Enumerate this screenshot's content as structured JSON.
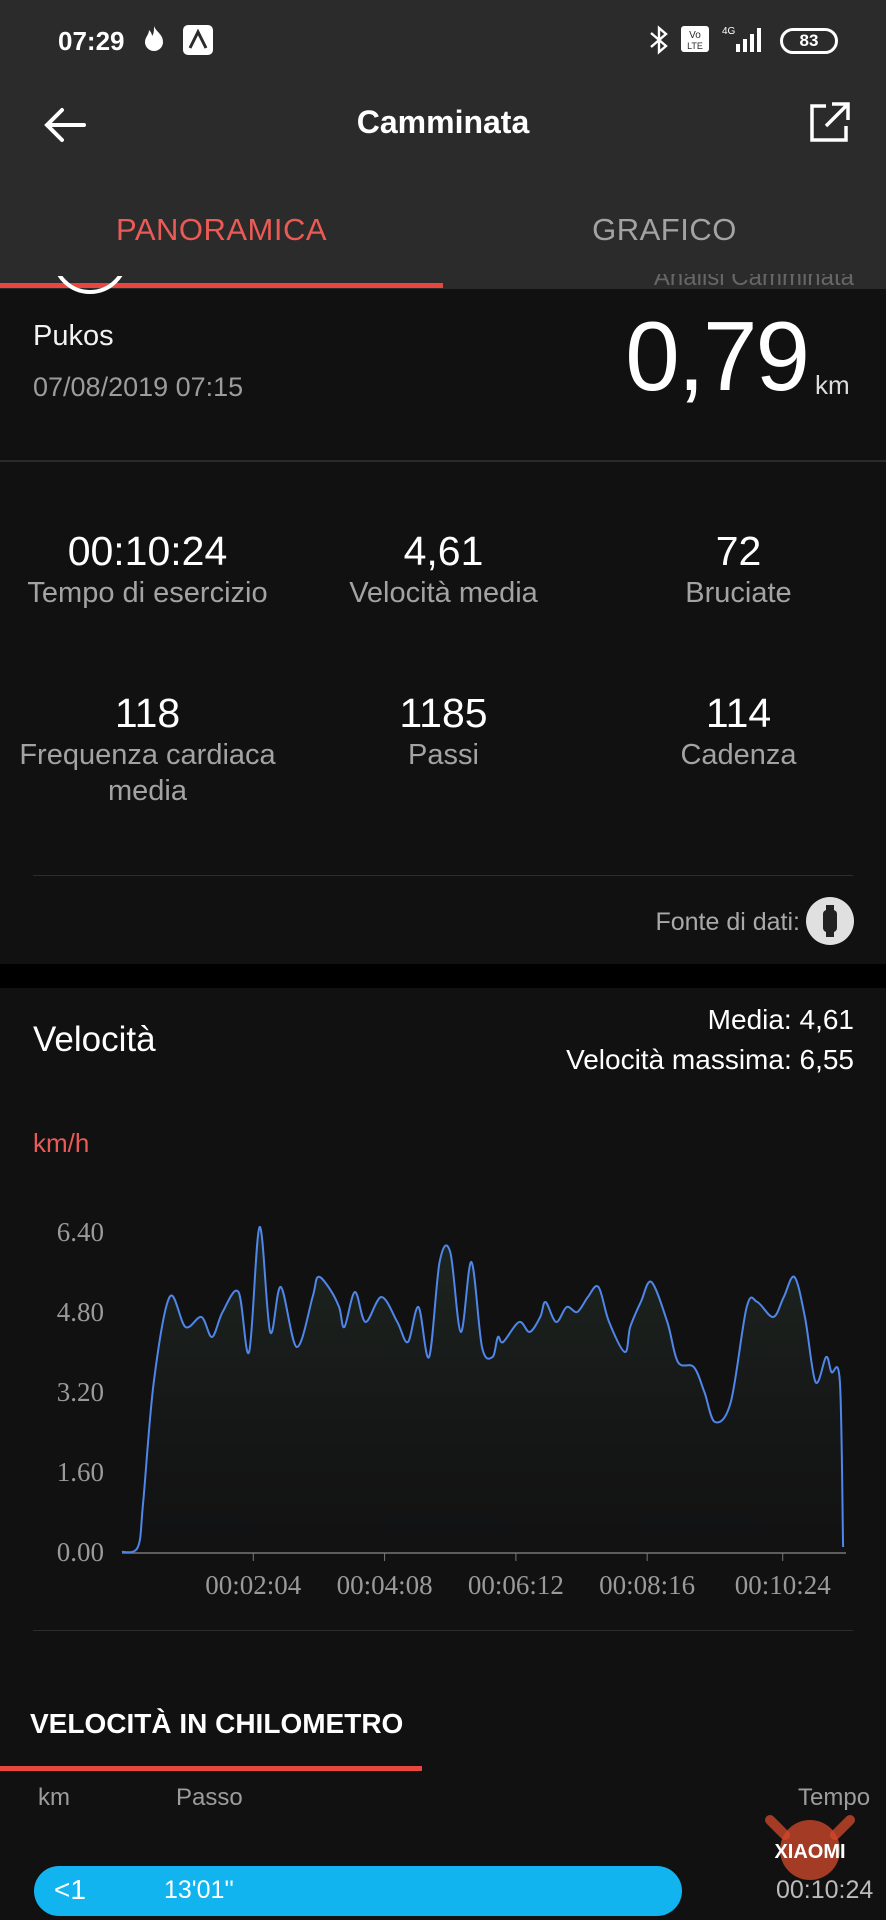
{
  "status_bar": {
    "time": "07:29",
    "battery": "83",
    "network": "4G"
  },
  "header": {
    "title": "Camminata"
  },
  "tabs": [
    {
      "label": "PANORAMICA",
      "active": true
    },
    {
      "label": "GRAFICO",
      "active": false
    }
  ],
  "summary": {
    "partial_text": "Analisi Camminata",
    "name": "Pukos",
    "datetime": "07/08/2019 07:15",
    "distance": "0,79",
    "distance_unit": "km"
  },
  "stats": [
    {
      "value": "00:10:24",
      "label": "Tempo di esercizio"
    },
    {
      "value": "4,61",
      "label": "Velocità media"
    },
    {
      "value": "72",
      "label": "Bruciate"
    },
    {
      "value": "118",
      "label": "Frequenza cardiaca media"
    },
    {
      "value": "1185",
      "label": "Passi"
    },
    {
      "value": "114",
      "label": "Cadenza"
    }
  ],
  "data_source": {
    "label": "Fonte di dati:"
  },
  "velocity": {
    "title": "Velocità",
    "media": "Media: 4,61",
    "max": "Velocità massima: 6,55",
    "unit": "km/h"
  },
  "chart_data": {
    "type": "area",
    "ylabel": "km/h",
    "ylim": [
      0,
      6.4
    ],
    "yticks": [
      "0.00",
      "1.60",
      "3.20",
      "4.80",
      "6.40"
    ],
    "xticks": [
      "00:02:04",
      "00:04:08",
      "00:06:12",
      "00:08:16",
      "00:10:24"
    ],
    "xlim_seconds": [
      0,
      680
    ],
    "line_color": "#4f86e8",
    "series": [
      {
        "x": [
          0,
          15,
          20,
          30,
          45,
          60,
          75,
          85,
          95,
          110,
          120,
          130,
          140,
          150,
          165,
          180,
          185,
          195,
          205,
          210,
          220,
          230,
          245,
          260,
          270,
          280,
          290,
          300,
          310,
          320,
          330,
          340,
          350,
          355,
          360,
          375,
          385,
          395,
          400,
          410,
          420,
          430,
          440,
          450,
          460,
          475,
          480,
          490,
          500,
          515,
          525,
          540,
          550,
          560,
          575,
          590,
          600,
          615,
          625,
          635,
          645,
          655,
          665,
          670,
          678,
          681
        ],
        "y": [
          0,
          0.1,
          1.0,
          3.4,
          5.1,
          4.5,
          4.7,
          4.3,
          4.8,
          5.2,
          4.0,
          6.5,
          4.4,
          5.3,
          4.1,
          5.1,
          5.5,
          5.3,
          4.9,
          4.5,
          5.2,
          4.6,
          5.1,
          4.6,
          4.2,
          4.9,
          3.9,
          5.8,
          6.0,
          4.4,
          5.8,
          4.1,
          3.9,
          4.3,
          4.2,
          4.6,
          4.4,
          4.7,
          5.0,
          4.6,
          4.9,
          4.8,
          5.1,
          5.3,
          4.6,
          4.0,
          4.5,
          5.0,
          5.4,
          4.6,
          3.8,
          3.7,
          3.2,
          2.6,
          3.0,
          4.9,
          5.0,
          4.7,
          5.1,
          5.5,
          4.7,
          3.4,
          3.9,
          3.6,
          3.4,
          0.1
        ]
      }
    ]
  },
  "km_section": {
    "title": "VELOCITÀ IN CHILOMETRO",
    "columns": [
      "km",
      "Passo",
      "Tempo"
    ],
    "rows": [
      {
        "km": "<1",
        "pace": "13'01''",
        "time": "00:10:24"
      }
    ]
  },
  "watermark": {
    "text": "XIAOMI"
  },
  "colors": {
    "accent": "#e8473f",
    "chart_line": "#4f86e8",
    "pill": "#12b4f0"
  }
}
